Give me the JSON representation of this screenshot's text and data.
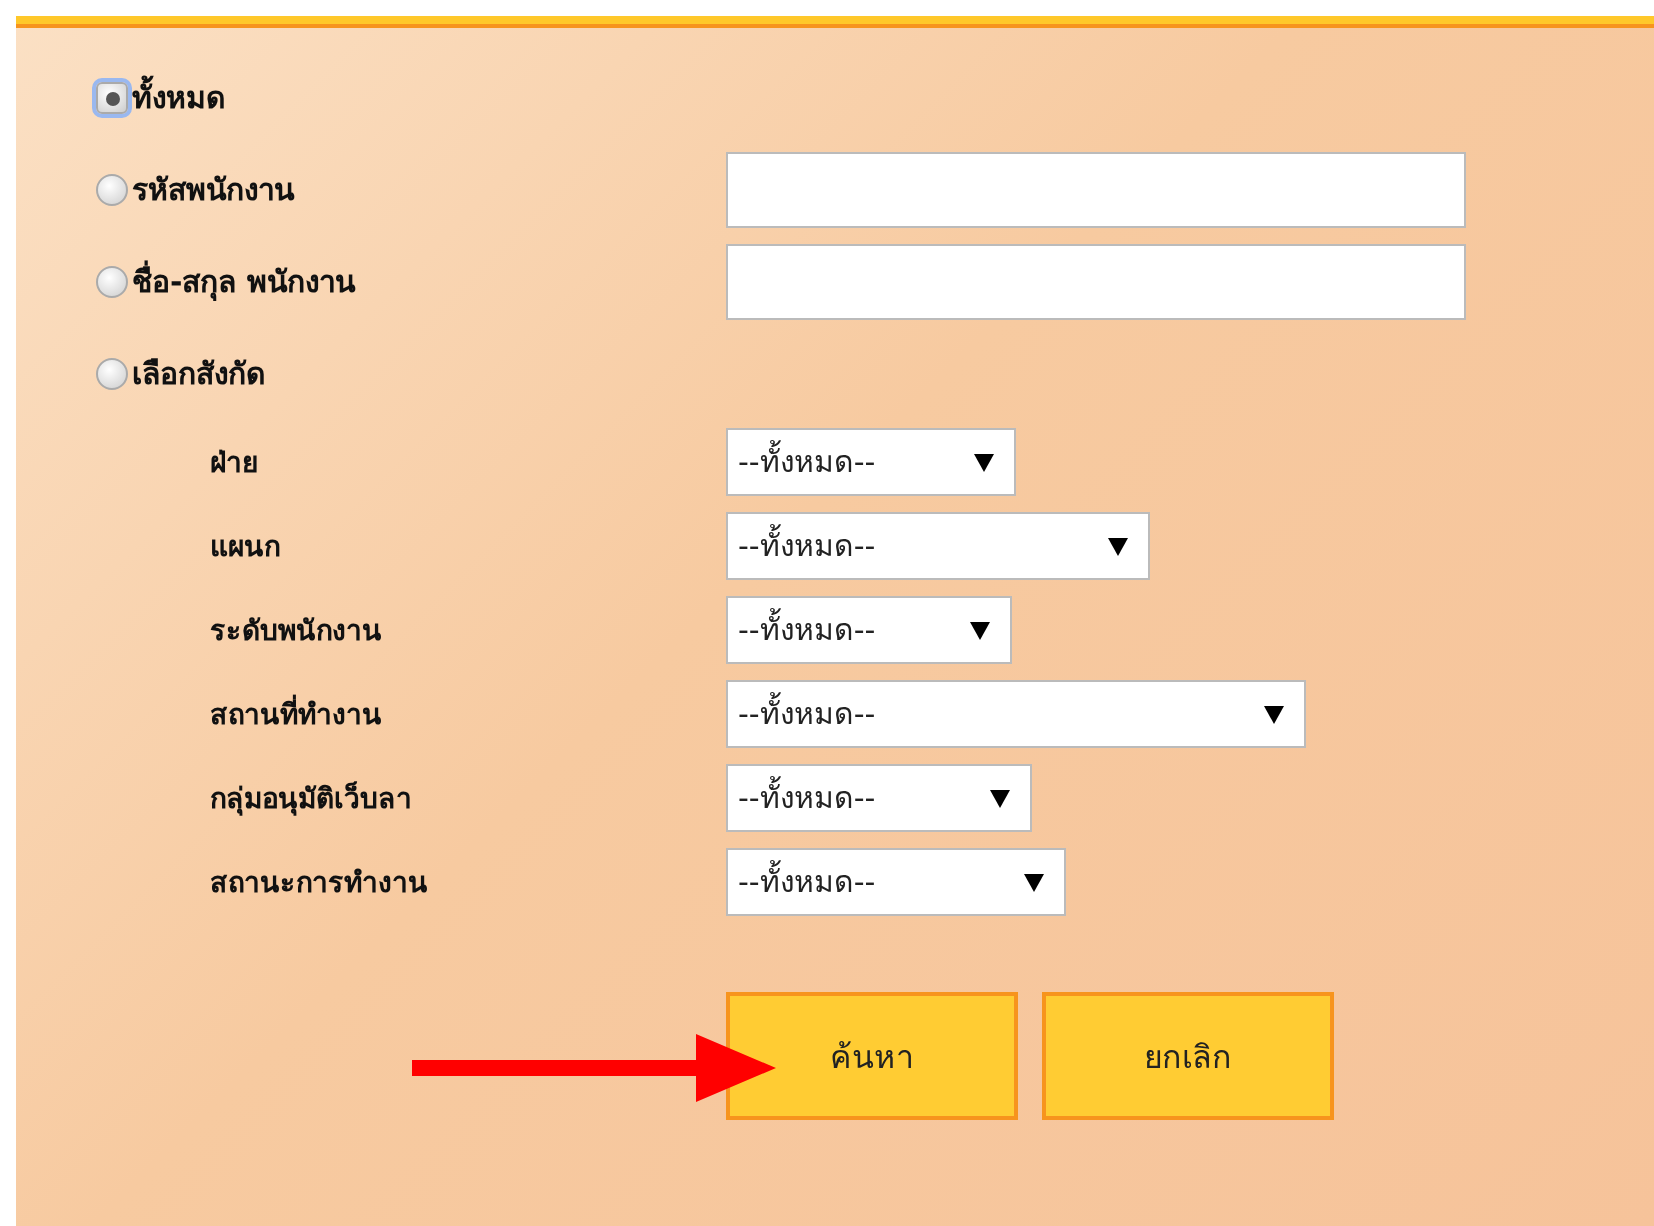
{
  "search_options": [
    {
      "label": "ทั้งหมด",
      "selected": true,
      "kind": "plain"
    },
    {
      "label": "รหัสพนักงาน",
      "selected": false,
      "kind": "field"
    },
    {
      "label": "ชื่อ-สกุล พนักงาน",
      "selected": false,
      "kind": "field"
    },
    {
      "label": "เลือกสังกัด",
      "selected": false,
      "kind": "plain"
    }
  ],
  "filters": [
    {
      "label": "ฝ่าย",
      "value": "--ทั้งหมด--"
    },
    {
      "label": "แผนก",
      "value": "--ทั้งหมด--"
    },
    {
      "label": "ระดับพนักงาน",
      "value": "--ทั้งหมด--"
    },
    {
      "label": "สถานที่ทำงาน",
      "value": "--ทั้งหมด--"
    },
    {
      "label": "กลุ่มอนุมัติเว็บลา",
      "value": "--ทั้งหมด--"
    },
    {
      "label": "สถานะการทำงาน",
      "value": "--ทั้งหมด--"
    }
  ],
  "buttons": [
    "ค้นหา",
    "ยกเลิก"
  ]
}
